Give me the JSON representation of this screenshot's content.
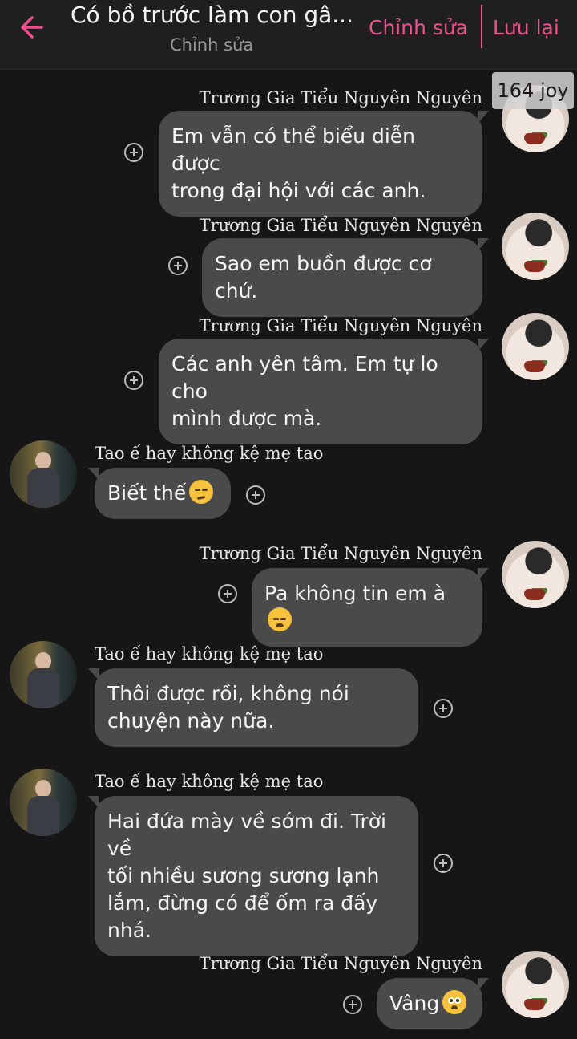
{
  "header": {
    "title": "Có bồ trước làm con gâ...",
    "subtitle": "Chỉnh sửa",
    "edit_label": "Chỉnh sửa",
    "save_label": "Lưu lại",
    "accent_color": "#f0508c"
  },
  "badge": "164 joy",
  "messages": [
    {
      "side": "right",
      "sender": "Trương Gia Tiểu Nguyên Nguyên",
      "line1": "Em vẫn có thể biểu diễn được",
      "line2": "trong đại hội với các anh."
    },
    {
      "side": "right",
      "sender": "Trương Gia Tiểu Nguyên Nguyên",
      "text": "Sao em buồn được cơ chứ."
    },
    {
      "side": "right",
      "sender": "Trương Gia Tiểu Nguyên Nguyên",
      "line1": "Các anh yên tâm. Em tự lo cho",
      "line2": "mình được mà."
    },
    {
      "side": "left",
      "sender": "Tao ế hay không kệ mẹ tao",
      "text": "Biết thế",
      "emoji": "unamused-face"
    },
    {
      "side": "right",
      "sender": "Trương Gia Tiểu Nguyên Nguyên",
      "text": "Pa không tin em à",
      "emoji": "disappointed-face"
    },
    {
      "side": "left",
      "sender": "Tao ế hay không kệ mẹ tao",
      "line1": "Thôi được rồi, không nói",
      "line2": "chuyện này nữa."
    },
    {
      "side": "left",
      "sender": "Tao ế hay không kệ mẹ tao",
      "line1": "Hai đứa mày về sớm đi. Trời về",
      "line2": "tối nhiều sương sương lạnh",
      "line3": "lắm, đừng có để ốm ra đấy",
      "line4": "nhá."
    },
    {
      "side": "right",
      "sender": "Trương Gia Tiểu Nguyên Nguyên",
      "text": "Vâng",
      "emoji": "pleading-face"
    }
  ]
}
